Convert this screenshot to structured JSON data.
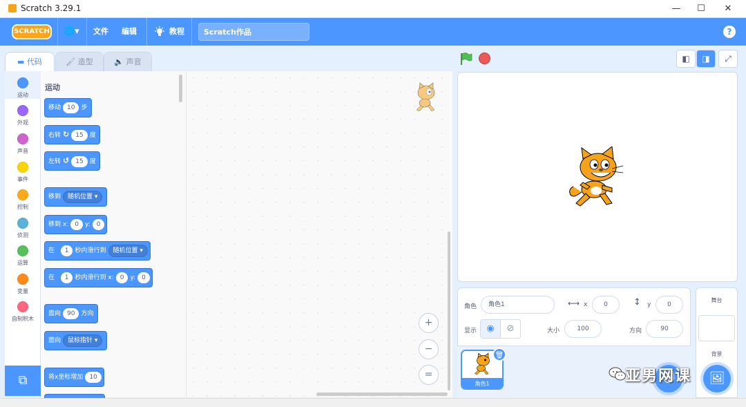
{
  "window": {
    "title": "Scratch 3.29.1",
    "minimize": "—",
    "maximize": "☐",
    "close": "✕"
  },
  "menubar": {
    "logo": "SCRATCH",
    "globe": "🌐▾",
    "file": "文件",
    "edit": "编辑",
    "tutorials": "教程",
    "project_title": "Scratch作品",
    "help": "?"
  },
  "tabs": {
    "code": "代码",
    "costumes": "造型",
    "sounds": "声音"
  },
  "categories": [
    {
      "label": "运动",
      "color": "#4c97ff"
    },
    {
      "label": "外观",
      "color": "#9966ff"
    },
    {
      "label": "声音",
      "color": "#cf63cf"
    },
    {
      "label": "事件",
      "color": "#ffd500"
    },
    {
      "label": "控制",
      "color": "#ffab19"
    },
    {
      "label": "侦测",
      "color": "#5cb1d6"
    },
    {
      "label": "运算",
      "color": "#59c059"
    },
    {
      "label": "变量",
      "color": "#ff8c1a"
    },
    {
      "label": "自制积木",
      "color": "#ff6680"
    }
  ],
  "palette": {
    "heading": "运动",
    "move": {
      "a": "移动",
      "v": "10",
      "b": "步"
    },
    "turn_right": {
      "a": "右转",
      "icon": "↻",
      "v": "15",
      "b": "度"
    },
    "turn_left": {
      "a": "左转",
      "icon": "↺",
      "v": "15",
      "b": "度"
    },
    "goto": {
      "a": "移到",
      "dd": "随机位置 ▾"
    },
    "goto_xy": {
      "a": "移到 x:",
      "x": "0",
      "b": "y:",
      "y": "0"
    },
    "glide": {
      "a": "在",
      "v": "1",
      "b": "秒内滑行到",
      "dd": "随机位置 ▾"
    },
    "glide_xy": {
      "a": "在",
      "v": "1",
      "b": "秒内滑行到 x:",
      "x": "0",
      "c": "y:",
      "y": "0"
    },
    "point_dir": {
      "a": "面向",
      "v": "90",
      "b": "方向"
    },
    "point_towards": {
      "a": "面向",
      "dd": "鼠标指针 ▾"
    },
    "change_x": {
      "a": "将x坐标增加",
      "v": "10"
    }
  },
  "script_area": {
    "zoom_in": "+",
    "zoom_out": "−",
    "zoom_reset": "="
  },
  "sprite_info": {
    "sprite_label": "角色",
    "sprite_name": "角色1",
    "x_label": "x",
    "x_value": "0",
    "y_label": "y",
    "y_value": "0",
    "show_label": "显示",
    "size_label": "大小",
    "size_value": "100",
    "direction_label": "方向",
    "direction_value": "90"
  },
  "sprite_list": {
    "sprite_name": "角色1"
  },
  "stage_selector": {
    "header": "舞台",
    "backdrop_label": "背景"
  },
  "watermark": "亚男网课"
}
